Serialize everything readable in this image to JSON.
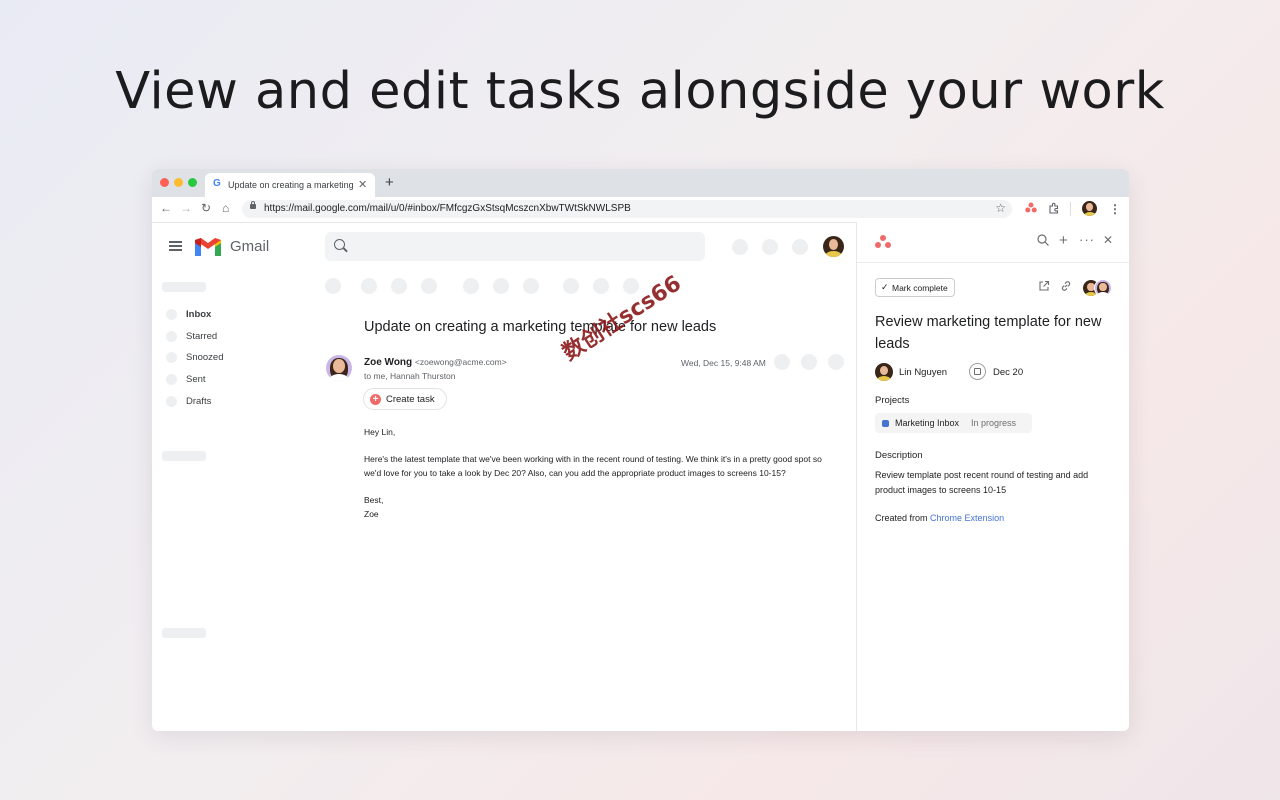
{
  "headline": "View and edit tasks alongside your work",
  "browser": {
    "tab_title": "Update on creating a marketing t",
    "tab_close": "✕",
    "new_tab": "+",
    "url": "https://mail.google.com/mail/u/0/#inbox/FMfcgzGxStsqMcszcnXbwTWtSkNWLSPB"
  },
  "gmail": {
    "brand": "Gmail",
    "nav": [
      "Inbox",
      "Starred",
      "Snoozed",
      "Sent",
      "Drafts"
    ],
    "email": {
      "subject": "Update on creating a marketing template for new leads",
      "sender_name": "Zoe Wong",
      "sender_email": "<zoewong@acme.com>",
      "recipients": "to me, Hannah Thurston",
      "date": "Wed, Dec 15, 9:48 AM",
      "create_task": "Create task",
      "greeting": "Hey Lin,",
      "body": "Here's the latest template that we've been working with in the recent round of testing. We think it's in a pretty good spot so we'd love for you to take a look by Dec 20? Also, can you add the appropriate product images to screens 10-15?",
      "signoff": "Best,",
      "signature": "Zoe"
    },
    "watermark": "数创社scs66"
  },
  "asana": {
    "mark_complete": "Mark complete",
    "task_title": "Review marketing template for new leads",
    "assignee": "Lin Nguyen",
    "due_date": "Dec 20",
    "projects_label": "Projects",
    "project_name": "Marketing Inbox",
    "project_status": "In progress",
    "description_label": "Description",
    "description": "Review template post recent round of testing and add product images to screens 10-15",
    "created_from_prefix": "Created from",
    "created_from_link": "Chrome Extension"
  },
  "colors": {
    "asana_coral": "#f06a6a",
    "link_blue": "#4573d2"
  }
}
